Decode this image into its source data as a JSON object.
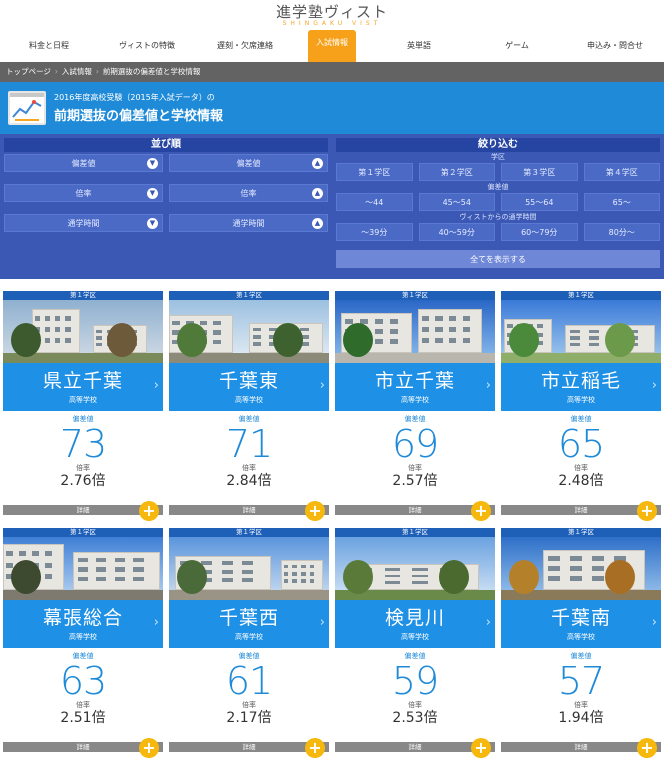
{
  "header": {
    "logo": "進学塾ヴィスト",
    "logo_sub": "SHINGAKU VIST"
  },
  "nav": {
    "items": [
      "料金と日程",
      "ヴィストの特徴",
      "遅刻・欠席連絡",
      "入試情報",
      "英単語",
      "ゲーム",
      "申込み・問合せ"
    ],
    "active": "入試情報"
  },
  "breadcrumb": [
    "トップページ",
    "入試情報",
    "前期選抜の偏差値と学校情報"
  ],
  "title": {
    "sub": "2016年度高校受験（2015年入試データ）の",
    "main": "前期選抜の偏差値と学校情報"
  },
  "filter": {
    "sort_head": "並び順",
    "sort_rows": [
      {
        "left": "偏差値",
        "right": "偏差値"
      },
      {
        "left": "倍率",
        "right": "倍率"
      },
      {
        "left": "通学時間",
        "right": "通学時間"
      }
    ],
    "narrow_head": "絞り込む",
    "district_label": "学区",
    "districts": [
      "第１学区",
      "第２学区",
      "第３学区",
      "第４学区"
    ],
    "score_label": "偏差値",
    "scores": [
      "～44",
      "45～54",
      "55～64",
      "65～"
    ],
    "commute_label": "ヴィストからの通学時間",
    "commutes": [
      "～39分",
      "40～59分",
      "60～79分",
      "80分～"
    ],
    "show_all": "全てを表示する"
  },
  "labels": {
    "score": "偏差値",
    "ratio": "倍率",
    "detail": "詳細",
    "type": "高等学校"
  },
  "schools": [
    {
      "district": "第１学区",
      "name": "県立千葉",
      "score": "73",
      "ratio": "2.76倍"
    },
    {
      "district": "第１学区",
      "name": "千葉東",
      "score": "71",
      "ratio": "2.84倍"
    },
    {
      "district": "第１学区",
      "name": "市立千葉",
      "score": "69",
      "ratio": "2.57倍"
    },
    {
      "district": "第１学区",
      "name": "市立稲毛",
      "score": "65",
      "ratio": "2.48倍"
    },
    {
      "district": "第１学区",
      "name": "幕張総合",
      "score": "63",
      "ratio": "2.51倍"
    },
    {
      "district": "第１学区",
      "name": "千葉西",
      "score": "61",
      "ratio": "2.17倍"
    },
    {
      "district": "第１学区",
      "name": "検見川",
      "score": "59",
      "ratio": "2.53倍"
    },
    {
      "district": "第１学区",
      "name": "千葉南",
      "score": "57",
      "ratio": "1.94倍"
    }
  ]
}
